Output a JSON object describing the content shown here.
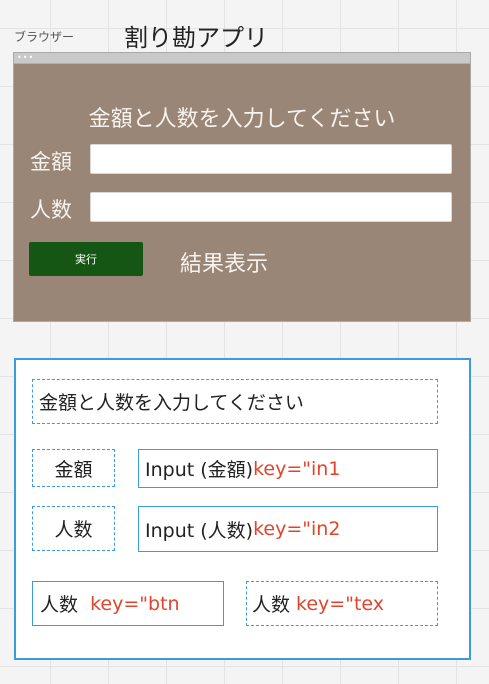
{
  "header": {
    "small_label": "ブラウザー",
    "title": "割り勘アプリ"
  },
  "mockup": {
    "window_dots": "•••",
    "heading": "金額と人数を入力してください",
    "amount_label": "金額",
    "people_label": "人数",
    "execute_button": "実行",
    "result_label": "結果表示"
  },
  "wireframe": {
    "heading_text": "金額と人数を入力してください",
    "amount_label": "金額",
    "amount_input_text": "Input (金額) ",
    "amount_input_key": "key=\"in1",
    "people_label": "人数",
    "people_input_text": "Input (人数) ",
    "people_input_key": "key=\"in2",
    "button_text": "人数  ",
    "button_key": "key=\"btn",
    "text_box_text": "人数 ",
    "text_box_key": "key=\"tex"
  },
  "colors": {
    "mockup_background": "#9a8676",
    "button_green": "#155614",
    "wire_blue": "#3d9ae0",
    "key_red": "#e0452b"
  }
}
